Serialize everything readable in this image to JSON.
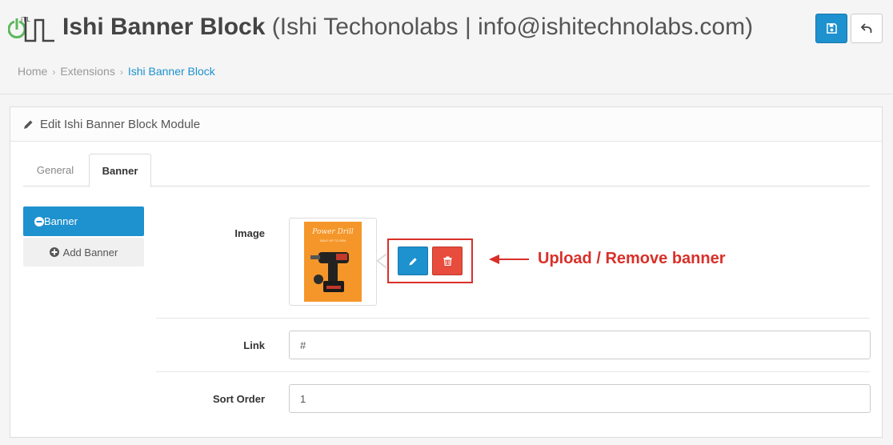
{
  "header": {
    "title_bold": "Ishi Banner Block",
    "title_sub": "(Ishi Techonolabs | info@ishitechnolabs.com)",
    "logo_text": "iTL"
  },
  "breadcrumb": [
    {
      "label": "Home"
    },
    {
      "label": "Extensions"
    },
    {
      "label": "Ishi Banner Block"
    }
  ],
  "breadcrumb_separator": "›",
  "panel": {
    "heading": "Edit Ishi Banner Block Module"
  },
  "tabs": [
    {
      "label": "General",
      "active": false
    },
    {
      "label": "Banner",
      "active": true
    }
  ],
  "sidebar": {
    "banner_label": "Banner",
    "add_label": "Add Banner"
  },
  "form": {
    "image_label": "Image",
    "link_label": "Link",
    "link_value": "#",
    "sort_label": "Sort Order",
    "sort_value": "1"
  },
  "banner_image": {
    "title": "Power Drill",
    "subtitle": "SALE UP TO 50%"
  },
  "annotation": {
    "text": "Upload / Remove banner"
  },
  "colors": {
    "primary": "#1e91cf",
    "danger": "#e74c3c",
    "annotation": "#d9302a",
    "banner_bg": "#f5962a"
  },
  "icons": {
    "save": "save-icon",
    "back": "reply-icon",
    "edit": "pencil-icon",
    "delete": "trash-icon",
    "minus": "minus-circle-icon",
    "add": "plus-circle-icon"
  }
}
